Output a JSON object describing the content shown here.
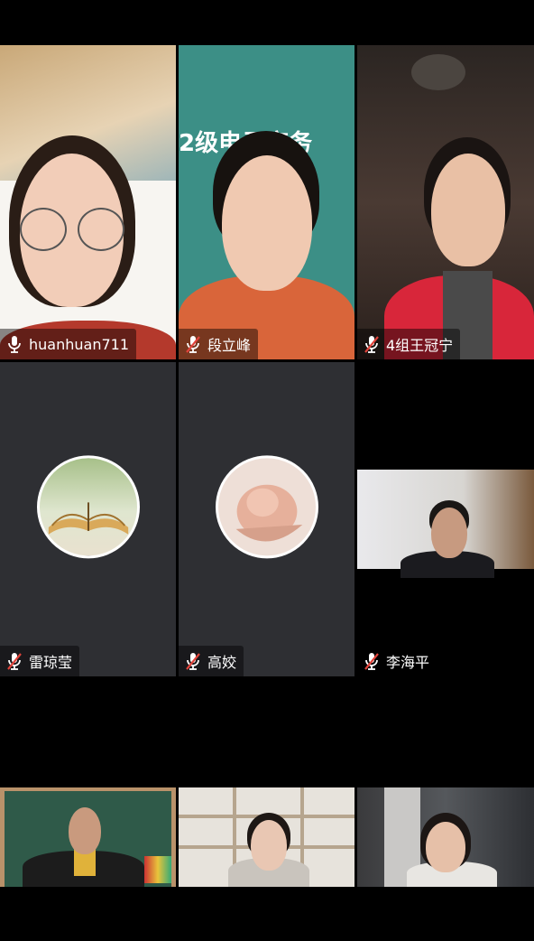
{
  "participants": [
    {
      "name": "huanhuan711",
      "mic": "mic-on-icon"
    },
    {
      "name": "段立峰",
      "mic": "mic-muted-icon"
    },
    {
      "name": "4组王冠宁",
      "mic": "mic-muted-icon"
    },
    {
      "name": "雷琼莹",
      "mic": "mic-muted-icon",
      "avatar": "book-avatar"
    },
    {
      "name": "高姣",
      "mic": "mic-muted-icon",
      "avatar": "baby-hand-avatar"
    },
    {
      "name": "李海平",
      "mic": "mic-muted-icon"
    }
  ],
  "banner_text": "2级电子商务",
  "colors": {
    "background": "#000000",
    "tile_dark": "#2e2f33",
    "label_text": "#ffffff",
    "muted_slash": "#e0433b"
  }
}
